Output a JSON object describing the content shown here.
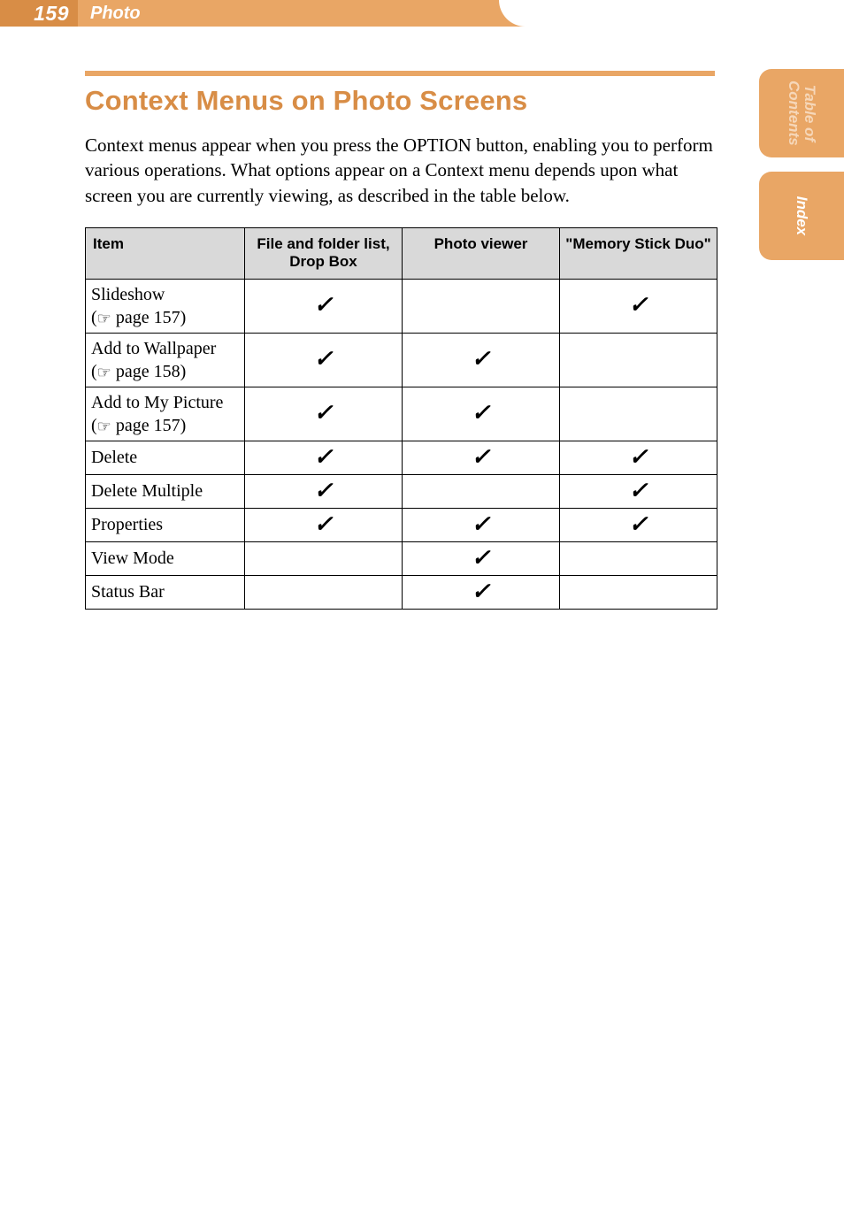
{
  "header": {
    "page_number": "159",
    "section": "Photo"
  },
  "side_tabs": {
    "toc": "Table of Contents",
    "index": "Index"
  },
  "main": {
    "heading": "Context Menus on Photo Screens",
    "intro": "Context menus appear when you press the OPTION button, enabling you to perform various operations. What options appear on a Context menu depends upon what screen you are currently viewing, as described in the table below."
  },
  "table": {
    "headers": {
      "item": "Item",
      "col1": "File and folder list, Drop Box",
      "col2": "Photo viewer",
      "col3": "\"Memory Stick Duo\""
    },
    "ref_left": "(",
    "ref_right": ")",
    "rows": [
      {
        "name": "Slideshow",
        "ref": " page 157",
        "c1": "✓",
        "c2": "",
        "c3": "✓"
      },
      {
        "name": "Add to Wallpaper",
        "ref": " page 158",
        "c1": "✓",
        "c2": "✓",
        "c3": ""
      },
      {
        "name": "Add to My Picture",
        "ref": " page 157",
        "c1": "✓",
        "c2": "✓",
        "c3": ""
      },
      {
        "name": "Delete",
        "ref": "",
        "c1": "✓",
        "c2": "✓",
        "c3": "✓"
      },
      {
        "name": "Delete Multiple",
        "ref": "",
        "c1": "✓",
        "c2": "",
        "c3": "✓"
      },
      {
        "name": "Properties",
        "ref": "",
        "c1": "✓",
        "c2": "✓",
        "c3": "✓"
      },
      {
        "name": "View Mode",
        "ref": "",
        "c1": "",
        "c2": "✓",
        "c3": ""
      },
      {
        "name": "Status Bar",
        "ref": "",
        "c1": "",
        "c2": "✓",
        "c3": ""
      }
    ]
  }
}
